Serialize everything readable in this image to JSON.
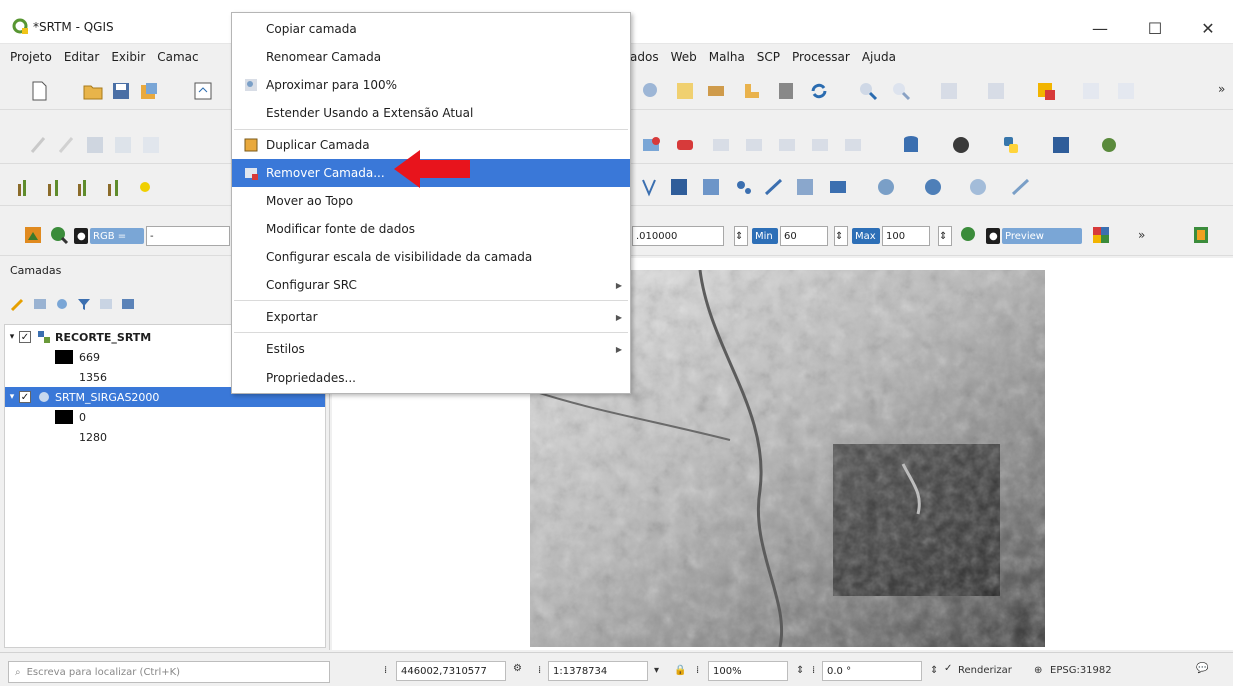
{
  "window": {
    "title": "*SRTM - QGIS",
    "controls": {
      "minimize": "—",
      "maximize": "☐",
      "close": "✕"
    }
  },
  "menubar": {
    "items": [
      "Projeto",
      "Editar",
      "Exibir",
      "Camac",
      "de dados",
      "Web",
      "Malha",
      "SCP",
      "Processar",
      "Ajuda"
    ]
  },
  "toolbar_raster": {
    "rgb_label": "RGB =",
    "rgb_value": "-",
    "value_field": ".010000",
    "min_label": "Min",
    "min_value": "60",
    "max_label": "Max",
    "max_value": "100",
    "preview_label": "Preview",
    "overflow": "»"
  },
  "layers_panel": {
    "title": "Camadas",
    "layers": [
      {
        "name": "RECORTE_SRTM",
        "checked": true,
        "expanded": true,
        "min": "669",
        "max": "1356",
        "selected": false
      },
      {
        "name": "SRTM_SIRGAS2000",
        "checked": true,
        "expanded": true,
        "min": "0",
        "max": "1280",
        "selected": true
      }
    ]
  },
  "context_menu": {
    "items": [
      {
        "label": "Copiar camada",
        "icon": "",
        "submenu": false,
        "active": false
      },
      {
        "label": "Renomear Camada",
        "icon": "",
        "submenu": false,
        "active": false
      },
      {
        "label": "Aproximar para 100%",
        "icon": "zoom-100-icon",
        "submenu": false,
        "active": false
      },
      {
        "label": "Estender Usando a Extensão Atual",
        "icon": "",
        "submenu": false,
        "active": false
      },
      {
        "label": "Duplicar Camada",
        "icon": "duplicate-icon",
        "submenu": false,
        "active": false
      },
      {
        "label": "Remover Camada...",
        "icon": "remove-layer-icon",
        "submenu": false,
        "active": true
      },
      {
        "label": "Mover ao Topo",
        "icon": "",
        "submenu": false,
        "active": false
      },
      {
        "label": "Modificar fonte de dados",
        "icon": "",
        "submenu": false,
        "active": false
      },
      {
        "label": "Configurar escala de visibilidade da camada",
        "icon": "",
        "submenu": false,
        "active": false
      },
      {
        "label": "Configurar SRC",
        "icon": "",
        "submenu": true,
        "active": false
      },
      {
        "label": "Exportar",
        "icon": "",
        "submenu": true,
        "active": false
      },
      {
        "label": "Estilos",
        "icon": "",
        "submenu": true,
        "active": false
      },
      {
        "label": "Propriedades...",
        "icon": "",
        "submenu": false,
        "active": false
      }
    ]
  },
  "statusbar": {
    "search_placeholder": "Escreva para localizar (Ctrl+K)",
    "coordinate": "446002,7310577",
    "scale": "1:1378734",
    "magnifier": "100%",
    "rotation": "0.0 °",
    "render_label": "Renderizar",
    "crs": "EPSG:31982"
  },
  "colors": {
    "accent": "#3a78d8",
    "arrow": "#e8141c"
  }
}
